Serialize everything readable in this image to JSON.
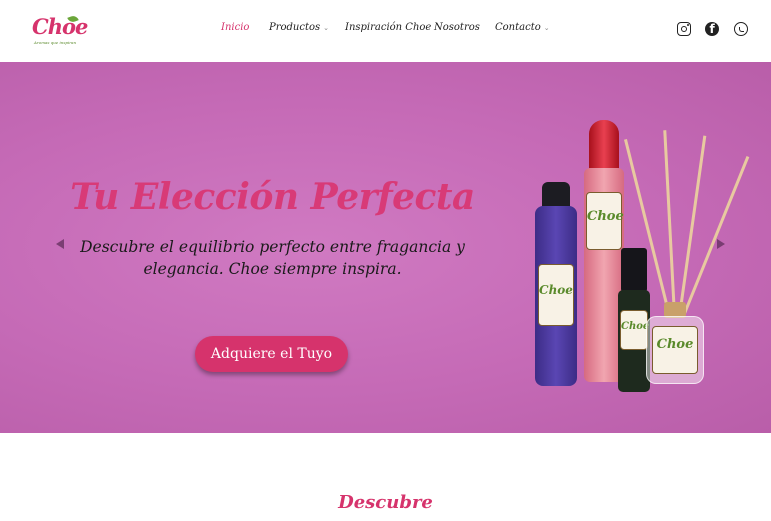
{
  "brand": {
    "logo_text": "Choe",
    "tagline": "Aromas que inspiran"
  },
  "nav": {
    "items": [
      {
        "label": "Inicio",
        "active": true,
        "dropdown": false
      },
      {
        "label": "Productos",
        "active": false,
        "dropdown": true
      },
      {
        "label": "Inspiración Choe",
        "active": false,
        "dropdown": false
      },
      {
        "label": "Nosotros",
        "active": false,
        "dropdown": false
      },
      {
        "label": "Contacto",
        "active": false,
        "dropdown": true
      }
    ]
  },
  "social": {
    "icons": [
      "instagram-icon",
      "facebook-icon",
      "whatsapp-icon"
    ]
  },
  "hero": {
    "title": "Tu Elección Perfecta",
    "subtitle": "Descubre el equilibrio perfecto entre fragancia y elegancia. Choe siempre inspira.",
    "button_label": "Adquiere el Tuyo",
    "product_label": "Choe"
  },
  "section": {
    "heading": "Descubre"
  },
  "colors": {
    "accent": "#d6336c",
    "hero_background": "#c56ab6"
  }
}
